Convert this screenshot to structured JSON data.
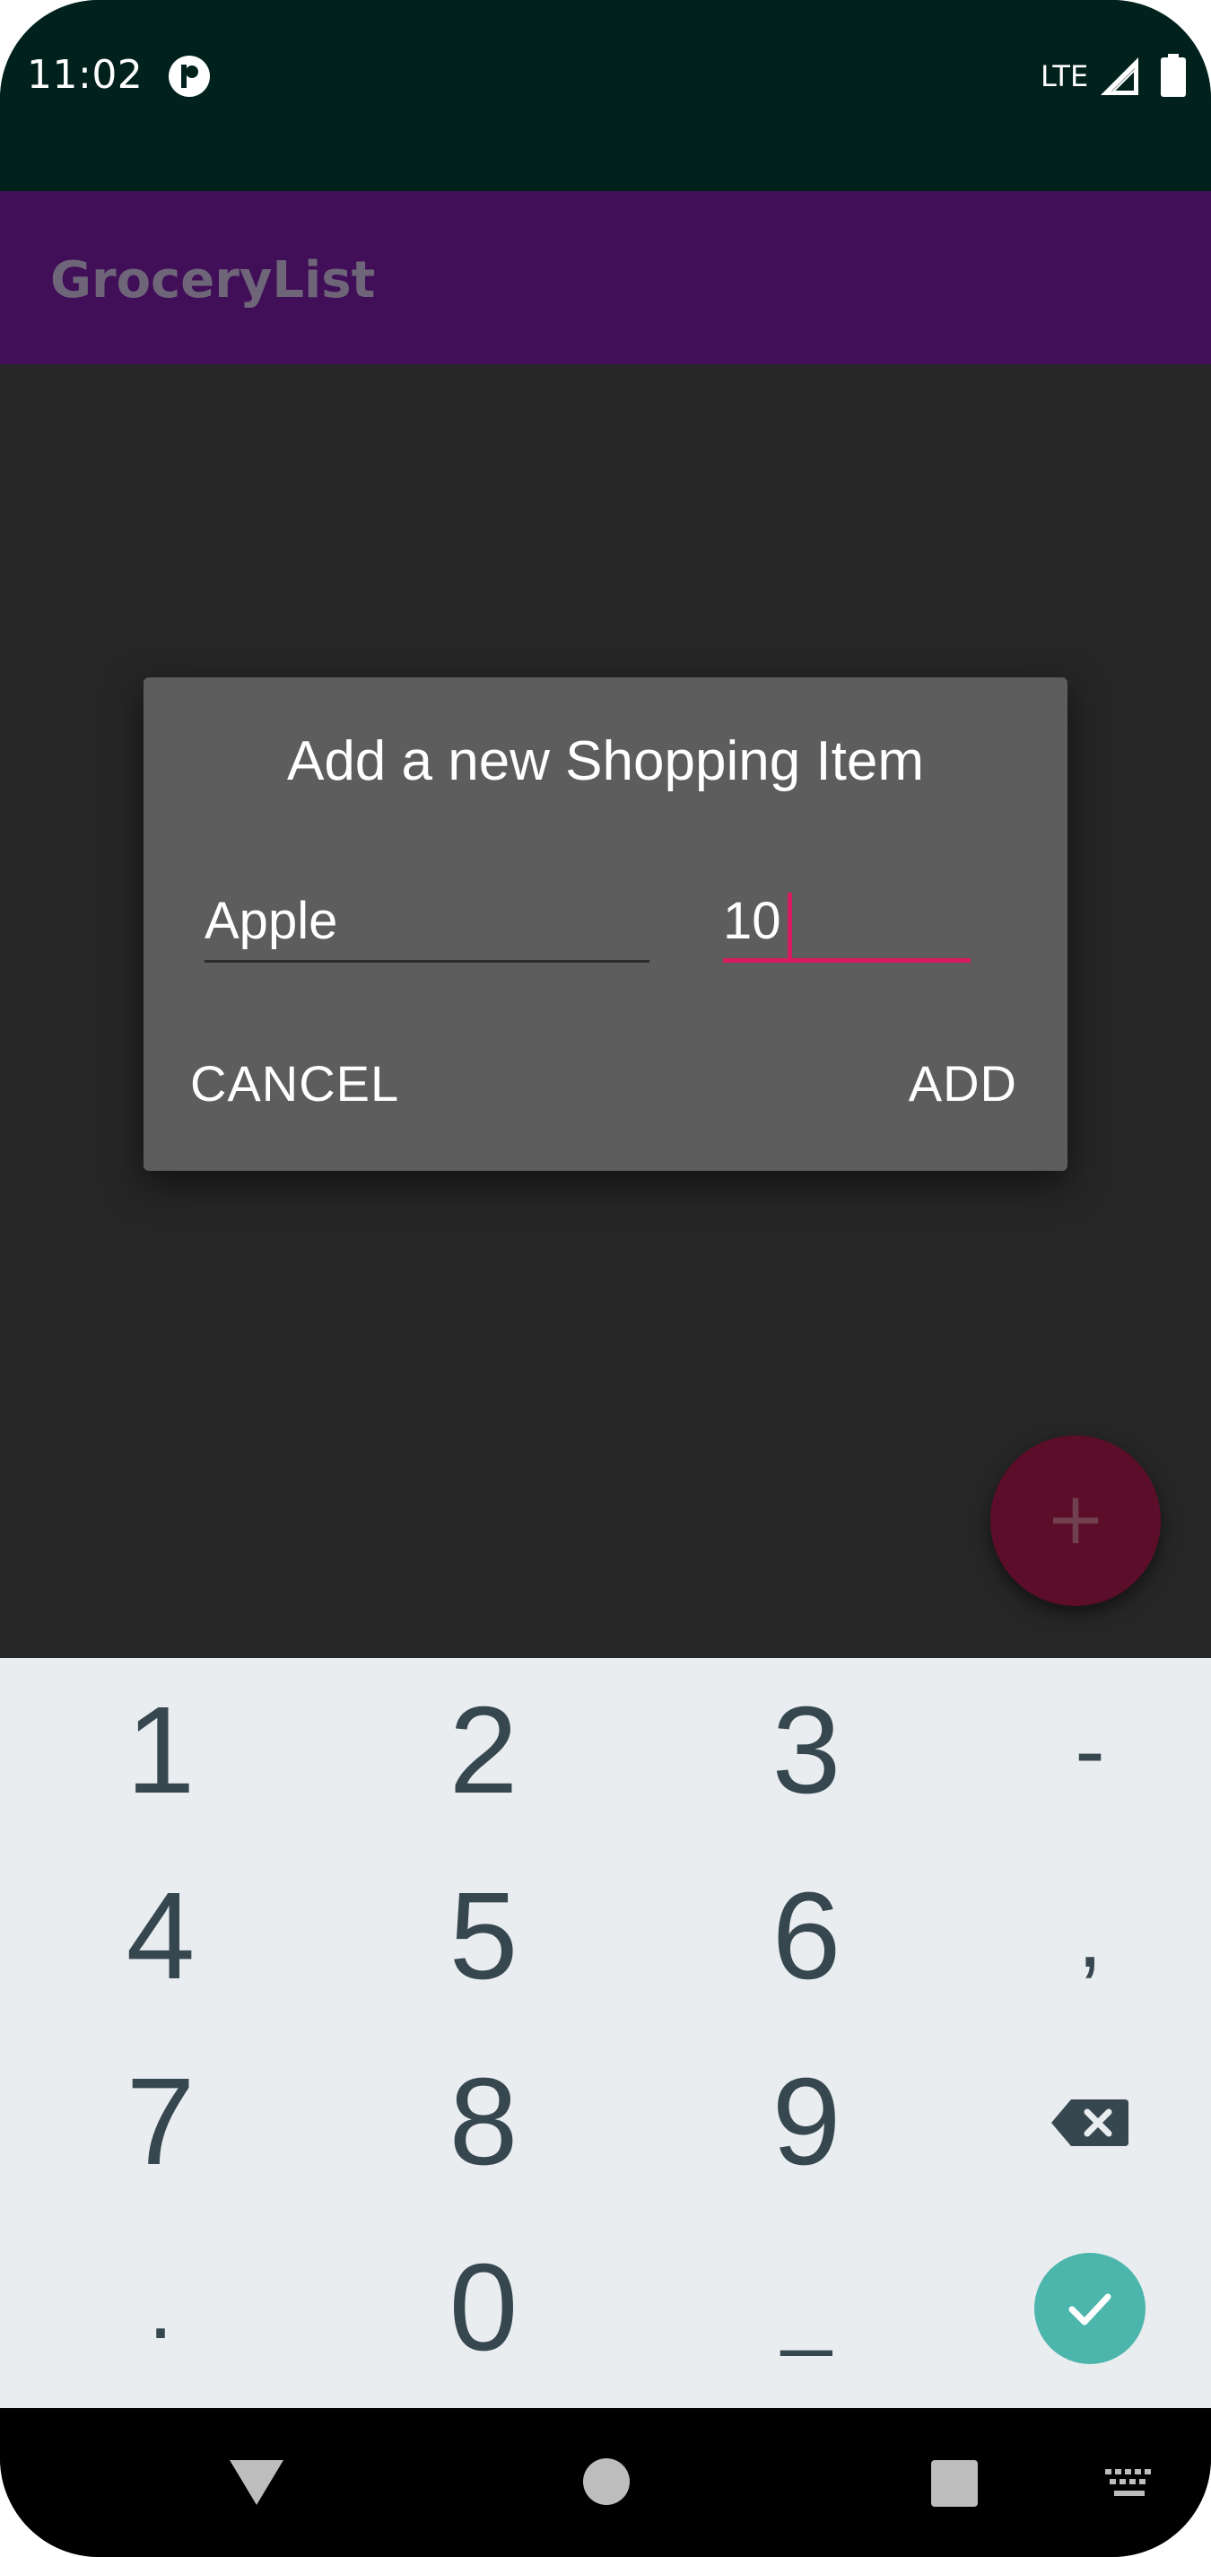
{
  "status_bar": {
    "time": "11:02",
    "network": "LTE",
    "app_icon": "pip-icon",
    "signal_icon": "signal-icon",
    "battery_icon": "battery-icon"
  },
  "app_bar": {
    "title": "GroceryList"
  },
  "dialog": {
    "title": "Add a new Shopping Item",
    "name_field_value": "Apple",
    "quantity_field_value": "10",
    "cancel_label": "CANCEL",
    "add_label": "ADD"
  },
  "fab": {
    "icon": "plus-icon",
    "label": "+"
  },
  "keyboard": {
    "rows": [
      [
        "1",
        "2",
        "3",
        "-"
      ],
      [
        "4",
        "5",
        "6",
        ","
      ],
      [
        "7",
        "8",
        "9",
        "backspace"
      ],
      [
        ".",
        "0",
        "_",
        "enter"
      ]
    ],
    "keys": {
      "k1": "1",
      "k2": "2",
      "k3": "3",
      "kminus": "-",
      "k4": "4",
      "k5": "5",
      "k6": "6",
      "kcomma": ",",
      "k7": "7",
      "k8": "8",
      "k9": "9",
      "kdot": ".",
      "k0": "0",
      "kspace": "_"
    },
    "backspace_icon": "backspace-icon",
    "enter_icon": "check-icon"
  },
  "nav_bar": {
    "back_icon": "back-triangle-icon",
    "home_icon": "home-circle-icon",
    "recents_icon": "recents-square-icon",
    "keyboard_icon": "keyboard-icon"
  },
  "colors": {
    "status_bar_bg": "#00211c",
    "app_bar_bg": "#410e58",
    "dialog_bg": "#5d5d5d",
    "accent": "#d81b60",
    "keyboard_bg": "#e9edf0",
    "enter_key": "#4db6ac"
  }
}
